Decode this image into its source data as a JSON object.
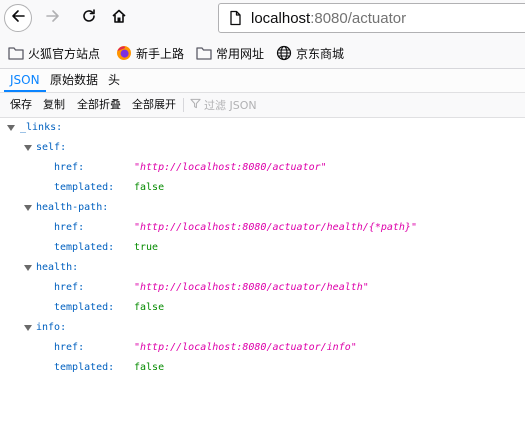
{
  "browser": {
    "url_host": "localhost",
    "url_rest": ":8080/actuator",
    "icons": {
      "back": "back-arrow-icon",
      "forward": "forward-arrow-icon",
      "reload": "reload-icon",
      "home": "home-icon",
      "page": "page-info-icon"
    }
  },
  "bookmarks": [
    {
      "label": "火狐官方站点",
      "icon": "folder-icon"
    },
    {
      "label": "新手上路",
      "icon": "firefox-icon"
    },
    {
      "label": "常用网址",
      "icon": "folder-icon"
    },
    {
      "label": "京东商城",
      "icon": "globe-icon"
    }
  ],
  "viewer_tabs": [
    {
      "label": "JSON",
      "selected": true
    },
    {
      "label": "原始数据",
      "selected": false
    },
    {
      "label": "头",
      "selected": false
    }
  ],
  "actions": {
    "save": "保存",
    "copy": "复制",
    "collapse_all": "全部折叠",
    "expand_all": "全部展开",
    "filter_placeholder": "过滤 JSON"
  },
  "json_tree": {
    "root_key": "_links:",
    "entries": [
      {
        "key": "self:",
        "href_key": "href:",
        "href": "\"http://localhost:8080/actuator\"",
        "templated_key": "templated:",
        "templated": "false"
      },
      {
        "key": "health-path:",
        "href_key": "href:",
        "href": "\"http://localhost:8080/actuator/health/{*path}\"",
        "templated_key": "templated:",
        "templated": "true"
      },
      {
        "key": "health:",
        "href_key": "href:",
        "href": "\"http://localhost:8080/actuator/health\"",
        "templated_key": "templated:",
        "templated": "false"
      },
      {
        "key": "info:",
        "href_key": "href:",
        "href": "\"http://localhost:8080/actuator/info\"",
        "templated_key": "templated:",
        "templated": "false"
      }
    ]
  },
  "colors": {
    "accent": "#0a84ff",
    "json_key": "#0060bf",
    "json_string": "#dd00a9",
    "json_bool": "#058b00"
  }
}
